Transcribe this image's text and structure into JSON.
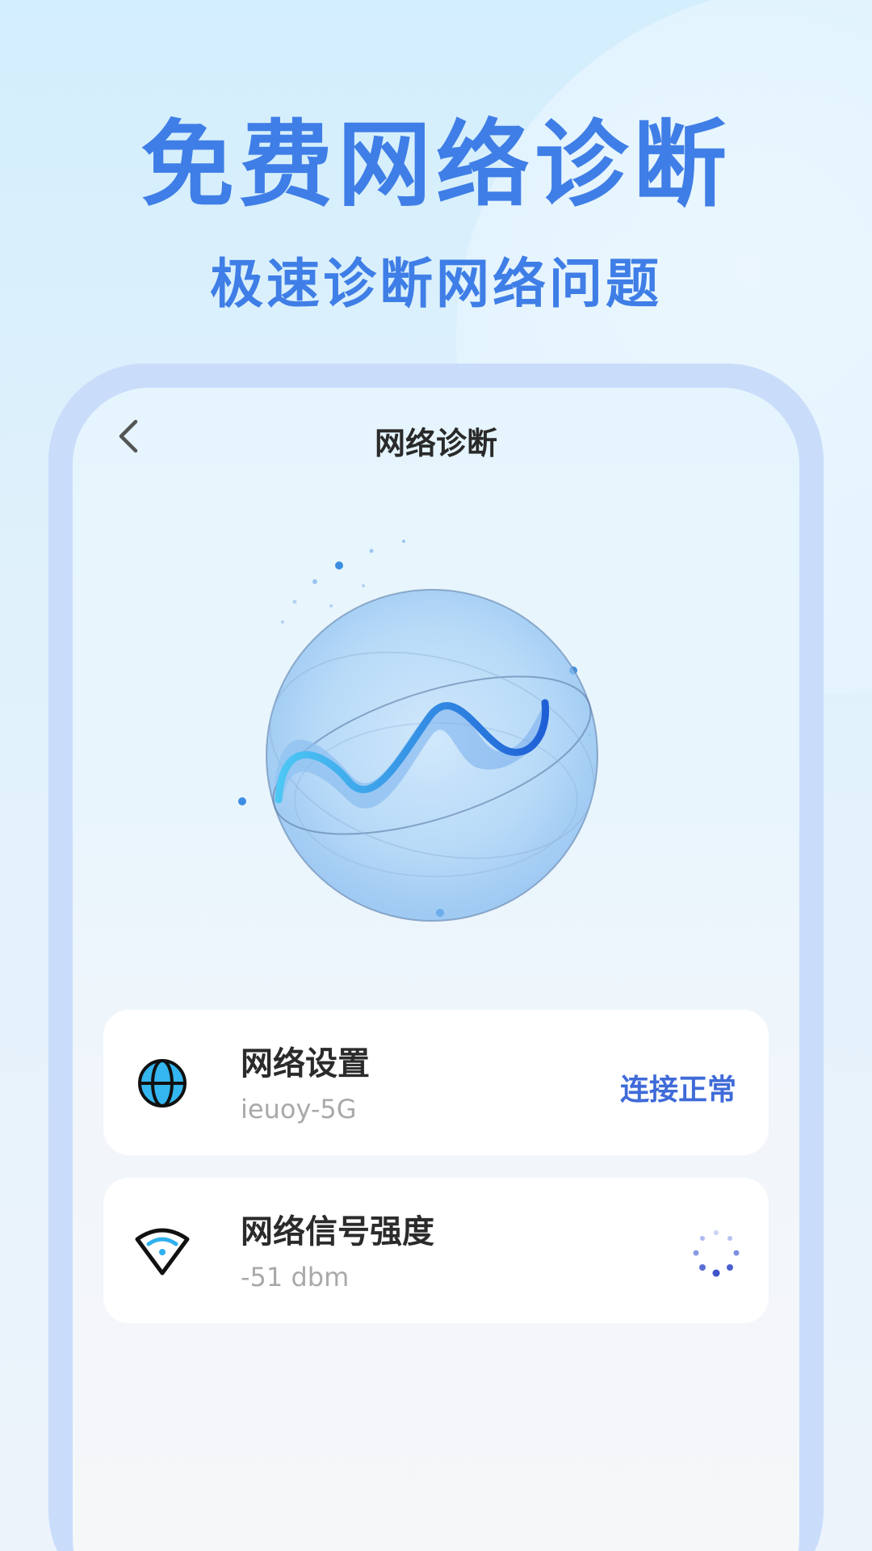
{
  "hero": {
    "title": "免费网络诊断",
    "subtitle": "极速诊断网络问题"
  },
  "screen": {
    "nav_title": "网络诊断",
    "back_icon": "chevron-left-icon"
  },
  "cards": [
    {
      "icon": "globe-icon",
      "title": "网络设置",
      "subtitle": "ieuoy-5G",
      "status": "连接正常"
    },
    {
      "icon": "wifi-signal-icon",
      "title": "网络信号强度",
      "subtitle": "-51 dbm",
      "status_icon": "loading-spinner-icon"
    }
  ],
  "colors": {
    "accent": "#3f7ee6",
    "status_blue": "#3f6bd8",
    "frame": "#c9ddfb"
  }
}
